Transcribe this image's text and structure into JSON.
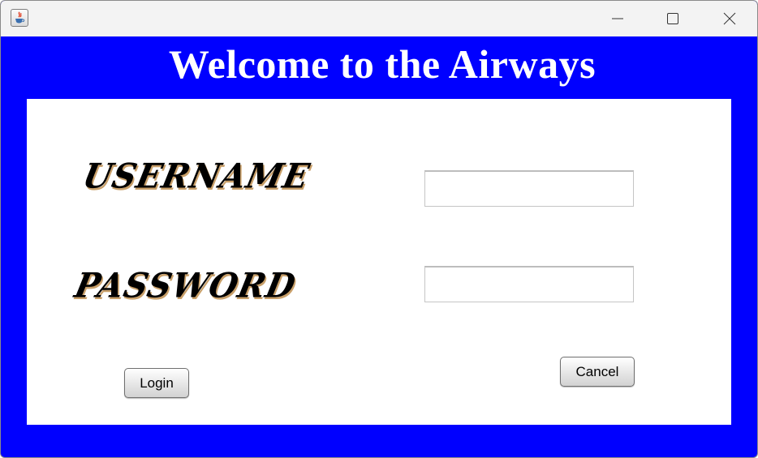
{
  "window": {
    "app_icon": "java-cup-icon",
    "controls": {
      "minimize": "minimize-icon",
      "maximize": "maximize-icon",
      "close": "close-icon"
    }
  },
  "header": {
    "title": "Welcome to the Airways",
    "background_color": "#0000ff",
    "text_color": "#ffffff"
  },
  "form": {
    "username_label": "USERNAME",
    "username_value": "",
    "password_label": "PASSWORD",
    "password_value": "",
    "login_label": "Login",
    "cancel_label": "Cancel"
  }
}
